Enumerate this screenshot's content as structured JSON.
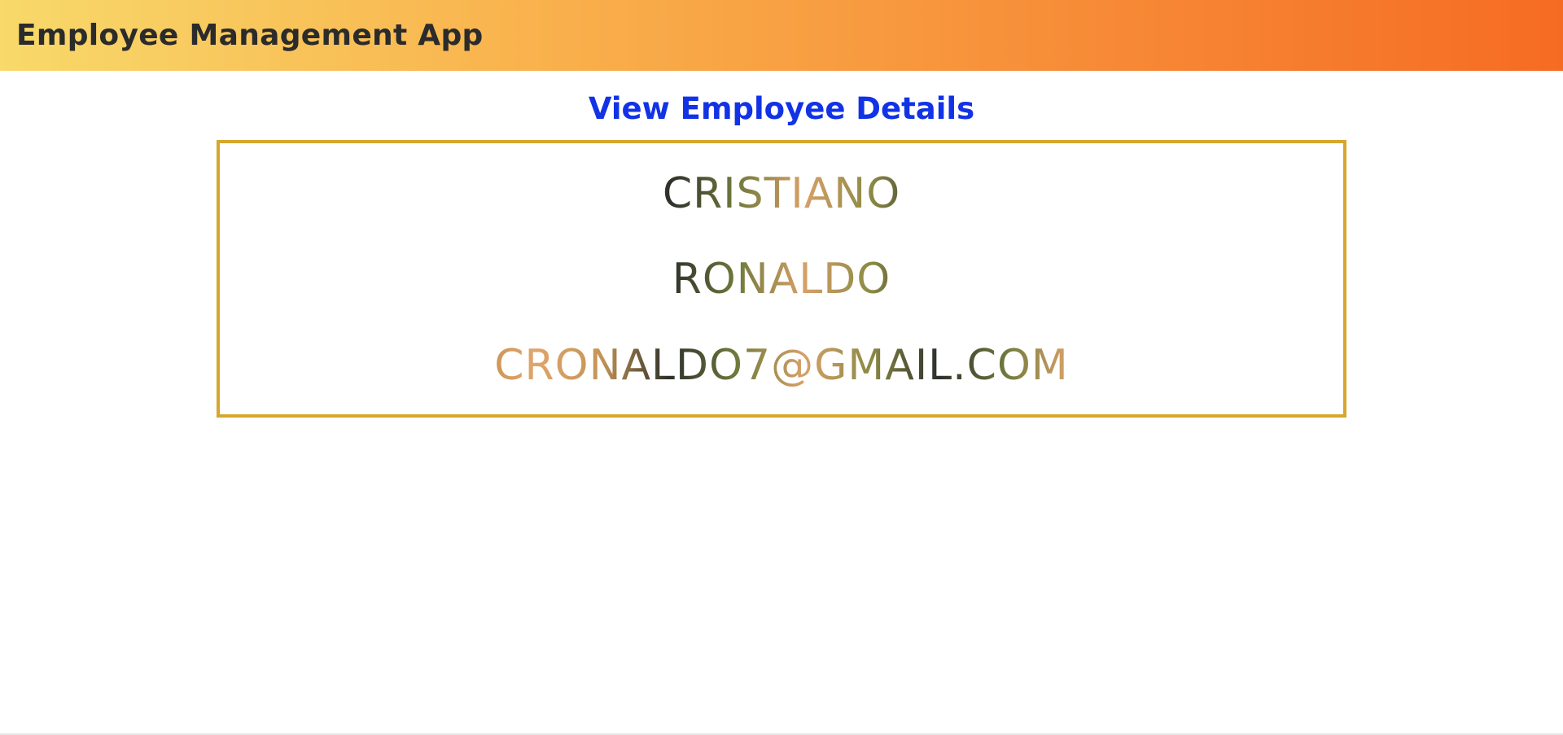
{
  "app": {
    "title": "Employee Management App"
  },
  "page": {
    "heading": "View Employee Details"
  },
  "employee": {
    "first_name": "CRISTIANO",
    "last_name": "RONALDO",
    "email": "CRONALDO7@GMAIL.COM"
  },
  "colors": {
    "navbar_gradient_start": "#f8d96a",
    "navbar_gradient_end": "#f66b22",
    "heading": "#1232e6",
    "card_border": "#d6a72c"
  }
}
